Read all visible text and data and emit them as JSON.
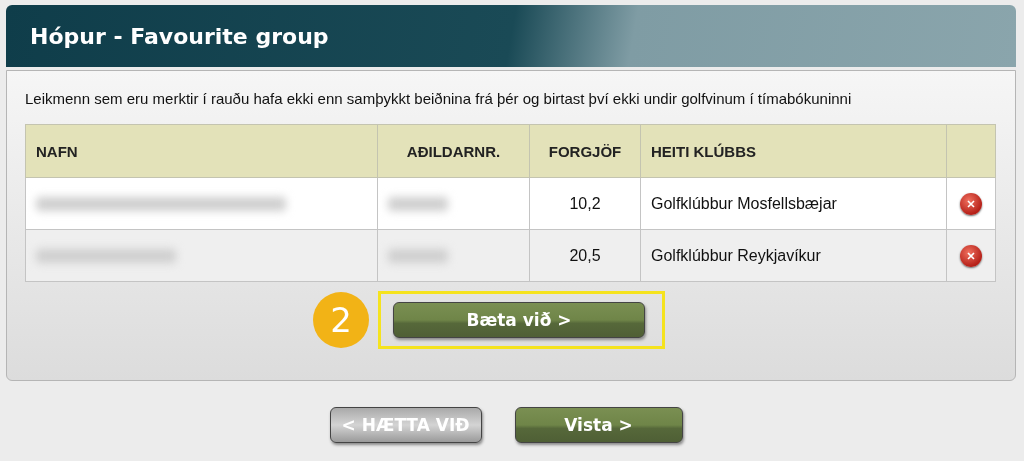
{
  "header": {
    "title": "Hópur - Favourite group"
  },
  "notice": "Leikmenn sem eru merktir í rauðu hafa ekki enn samþykkt beiðnina frá þér og birtast því ekki undir golfvinum í tímabókuninni",
  "table": {
    "columns": [
      "NAFN",
      "AÐILDARNR.",
      "FORGJÖF",
      "HEITI KLÚBBS"
    ],
    "rows": [
      {
        "handicap": "10,2",
        "club": "Golfklúbbur Mosfellsbæjar"
      },
      {
        "handicap": "20,5",
        "club": "Golfklúbbur Reykjavíkur"
      }
    ]
  },
  "step_badge": "2",
  "add_button": "Bæta við >",
  "buttons": [
    {
      "label": "< HÆTTA VIÐ",
      "kind": "cancel"
    },
    {
      "label": "Vista >",
      "kind": "primary"
    }
  ]
}
